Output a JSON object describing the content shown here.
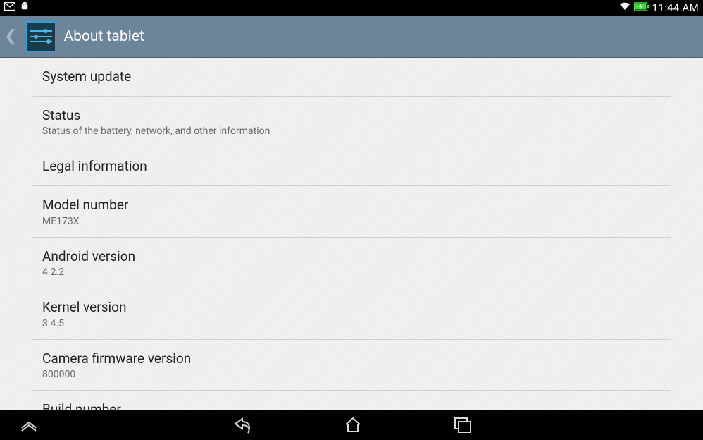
{
  "statusbar": {
    "time": "11:44 AM"
  },
  "header": {
    "title": "About tablet"
  },
  "items": [
    {
      "title": "System update",
      "sub": null
    },
    {
      "title": "Status",
      "sub": "Status of the battery, network, and other information"
    },
    {
      "title": "Legal information",
      "sub": null
    },
    {
      "title": "Model number",
      "sub": "ME173X"
    },
    {
      "title": "Android version",
      "sub": "4.2.2"
    },
    {
      "title": "Kernel version",
      "sub": "3.4.5"
    },
    {
      "title": "Camera firmware version",
      "sub": "800000"
    },
    {
      "title": "Build number",
      "sub": null
    }
  ]
}
